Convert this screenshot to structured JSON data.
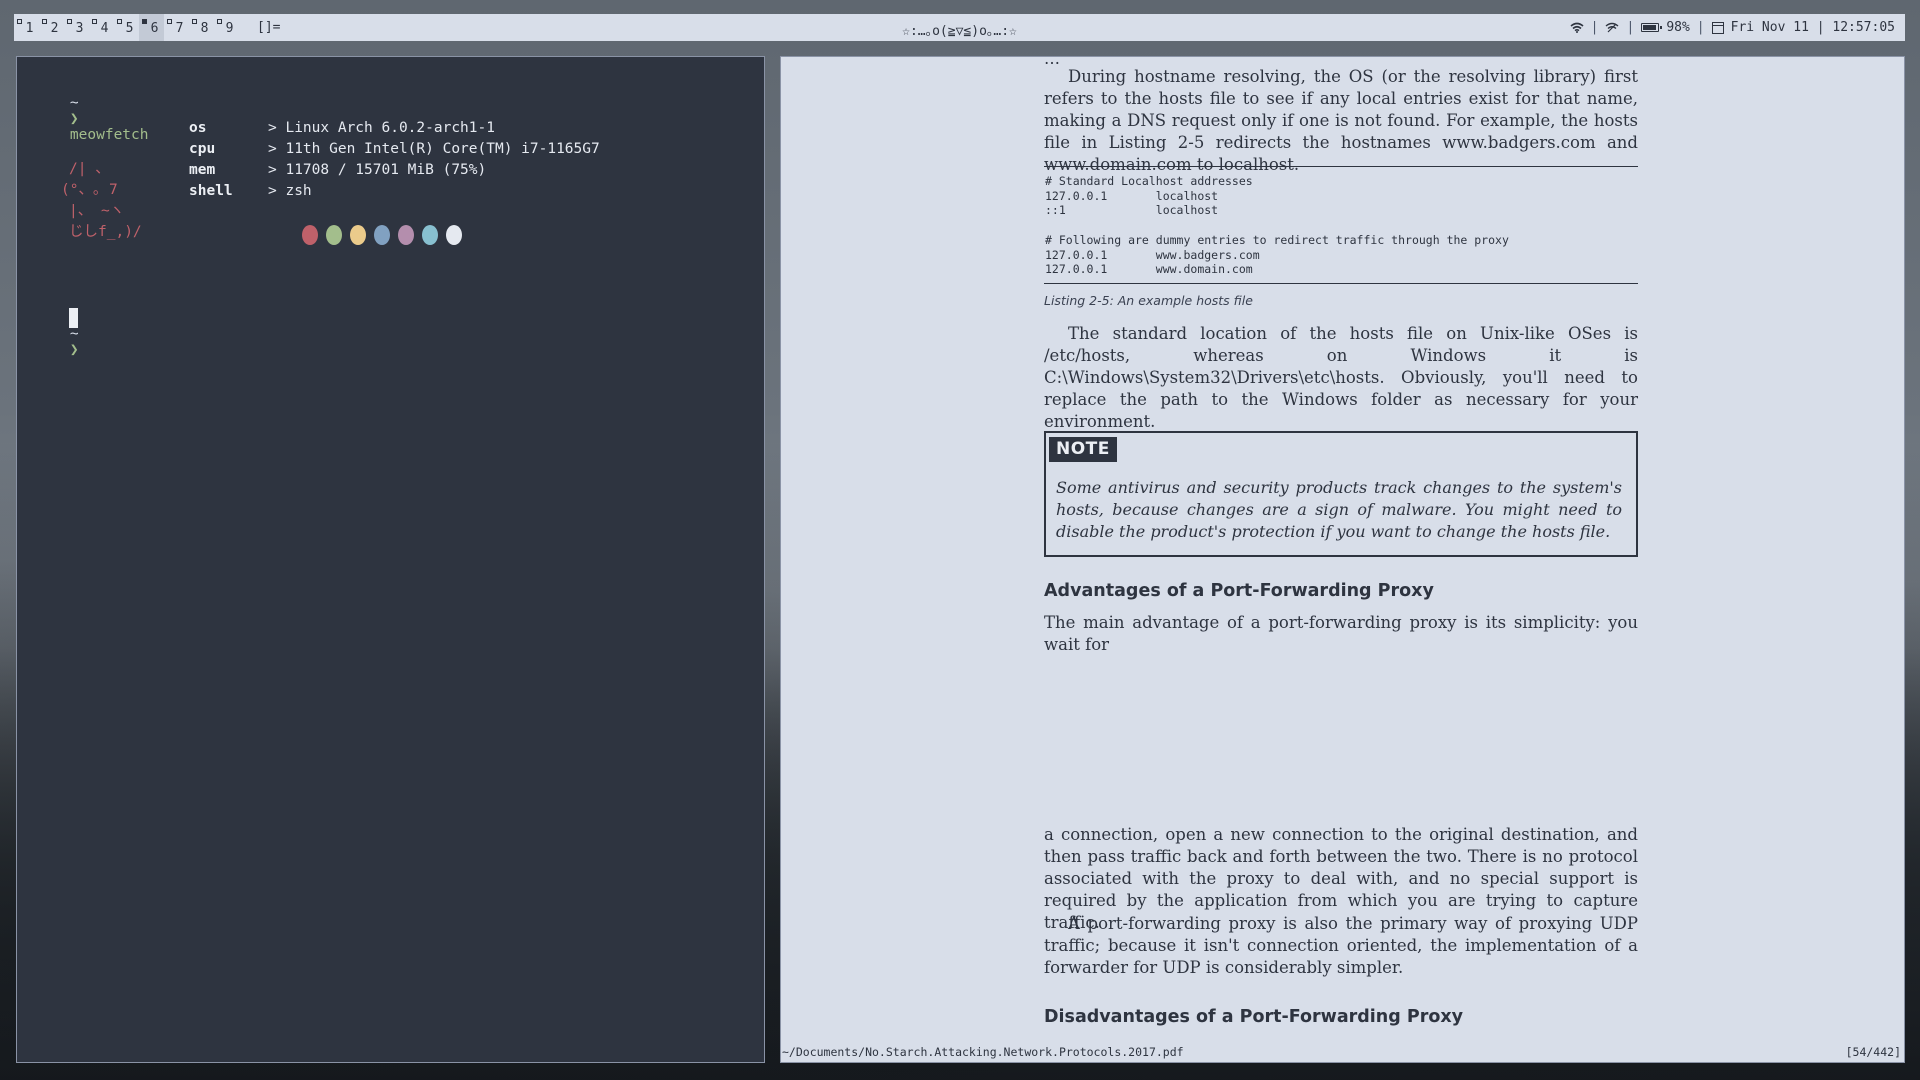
{
  "topbar": {
    "workspaces": [
      {
        "num": "1",
        "occupied": false,
        "active": false
      },
      {
        "num": "2",
        "occupied": false,
        "active": false
      },
      {
        "num": "3",
        "occupied": false,
        "active": false
      },
      {
        "num": "4",
        "occupied": false,
        "active": false
      },
      {
        "num": "5",
        "occupied": false,
        "active": false
      },
      {
        "num": "6",
        "occupied": true,
        "active": true
      },
      {
        "num": "7",
        "occupied": false,
        "active": false
      },
      {
        "num": "8",
        "occupied": false,
        "active": false
      },
      {
        "num": "9",
        "occupied": false,
        "active": false
      }
    ],
    "layout_symbol": "[]=",
    "title": "☆:…｡o(≧▽≦)o｡…:☆",
    "battery": "98%",
    "datetime": "Fri Nov 11 | 12:57:05",
    "sep": "|",
    "icons": [
      "wifi-icon",
      "network-icon",
      "battery-icon",
      "calendar-icon"
    ]
  },
  "terminal": {
    "prompt_tilde": "~",
    "prompt_arrow": "❯",
    "command": "meowfetch",
    "ascii_art": [
      "/| 、",
      "(°、｡ 7",
      "|、 ~ヽ",
      "じしf_,)/"
    ],
    "fetch": [
      {
        "key": "os",
        "value": "> Linux Arch 6.0.2-arch1-1"
      },
      {
        "key": "cpu",
        "value": "> 11th Gen Intel(R) Core(TM) i7-1165G7"
      },
      {
        "key": "mem",
        "value": "> 11708 / 15701 MiB (75%)"
      },
      {
        "key": "shell",
        "value": "> zsh"
      }
    ],
    "palette": [
      "#bf616a",
      "#a3be8c",
      "#ebcb8b",
      "#81a1c1",
      "#b48ead",
      "#88c0d0",
      "#e5e9f0"
    ]
  },
  "pdf": {
    "para1_text": "During hostname resolving, the OS (or the resolving library) first refers to the hosts file to see if any local entries exist for that name, making a DNS request only if one is not found. For example, the hosts file in Listing 2-5 redirects the hostnames www.badgers.com and www.domain.com to localhost.",
    "code_lines": [
      "# Standard Localhost addresses",
      "127.0.0.1       localhost",
      "::1             localhost",
      "",
      "# Following are dummy entries to redirect traffic through the proxy",
      "127.0.0.1       www.badgers.com",
      "127.0.0.1       www.domain.com"
    ],
    "caption": "Listing 2-5: An example hosts file",
    "para2_text": "The standard location of the hosts file on Unix-like OSes is /etc/hosts, whereas on Windows it is C:\\Windows\\System32\\Drivers\\etc\\hosts. Obviously, you'll need to replace the path to the Windows folder as necessary for your environment.",
    "note_label": "NOTE",
    "note_text": "Some antivirus and security products track changes to the system's hosts, because changes are a sign of malware. You might need to disable the product's protection if you want to change the hosts file.",
    "heading1": "Advantages of a Port-Forwarding Proxy",
    "para3_text": "The main advantage of a port-forwarding proxy is its simplicity: you wait for",
    "para4_text": "a connection, open a new connection to the original destination, and then pass traffic back and forth between the two. There is no protocol associated with the proxy to deal with, and no special support is required by the application from which you are trying to capture traffic.",
    "para5_text": "A port-forwarding proxy is also the primary way of proxying UDP traffic; because it isn't connection oriented, the implementation of a forwarder for UDP is considerably simpler.",
    "heading2": "Disadvantages of a Port-Forwarding Proxy",
    "status_path": "~/Documents/No.Starch.Attacking.Network.Protocols.2017.pdf",
    "status_page": "[54/442]"
  }
}
